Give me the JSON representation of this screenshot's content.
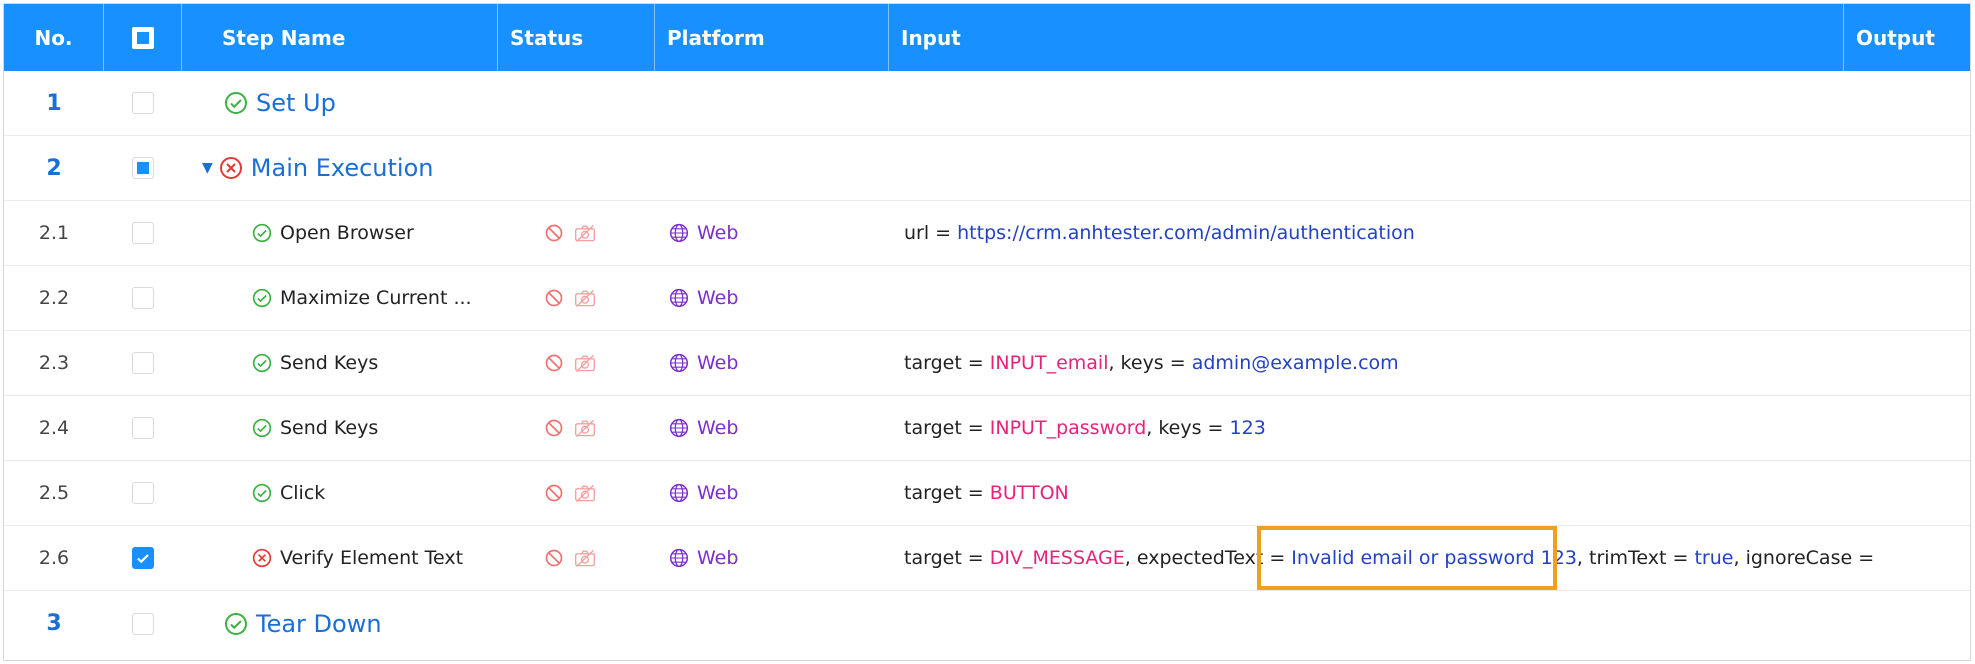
{
  "header": {
    "no": "No.",
    "step_name": "Step Name",
    "status": "Status",
    "platform": "Platform",
    "input": "Input",
    "output": "Output"
  },
  "colors": {
    "header_bg": "#1890ff",
    "step_top": "#1a6fd6",
    "success": "#3cb043",
    "fail": "#e53935",
    "platform": "#7b2fd0",
    "param_ref": "#e8227a",
    "param_value": "#2240c8",
    "highlight": "#f0a020"
  },
  "rows": [
    {
      "no": "1",
      "name": "Set Up",
      "result": "success",
      "level": "top"
    },
    {
      "no": "2",
      "name": "Main Execution",
      "result": "fail",
      "level": "top",
      "expanded": true
    },
    {
      "no": "2.1",
      "name": "Open Browser",
      "result": "success",
      "platform": "Web",
      "input": {
        "p1_key": "url = ",
        "p1_val": "https://crm.anhtester.com/admin/authentication"
      }
    },
    {
      "no": "2.2",
      "name": "Maximize Current ...",
      "result": "success",
      "platform": "Web"
    },
    {
      "no": "2.3",
      "name": "Send Keys",
      "result": "success",
      "platform": "Web",
      "input": {
        "p1_key": "target = ",
        "p1_val": "INPUT_email",
        "p2_key": ", keys = ",
        "p2_val": "admin@example.com"
      }
    },
    {
      "no": "2.4",
      "name": "Send Keys",
      "result": "success",
      "platform": "Web",
      "input": {
        "p1_key": "target = ",
        "p1_val": "INPUT_password",
        "p2_key": ", keys = ",
        "p2_val": "123"
      }
    },
    {
      "no": "2.5",
      "name": "Click",
      "result": "success",
      "platform": "Web",
      "input": {
        "p1_key": "target = ",
        "p1_val": "BUTTON"
      }
    },
    {
      "no": "2.6",
      "name": "Verify Element Text",
      "result": "fail",
      "platform": "Web",
      "checked": true,
      "input": {
        "p1_key": "target = ",
        "p1_val": "DIV_MESSAGE",
        "p2_key": ", expectedText = ",
        "p2_val": "Invalid email or password 123",
        "p3_key": ", trimText = ",
        "p3_val": "true",
        "p4_key": ", ignoreCase = "
      }
    },
    {
      "no": "3",
      "name": "Tear Down",
      "result": "success",
      "level": "top"
    }
  ],
  "icons": {
    "success": "check-circle-icon",
    "fail": "close-circle-icon",
    "status_a": "stop-icon",
    "status_b": "camera-off-icon",
    "platform": "globe-icon",
    "expand": "caret-down-icon"
  }
}
